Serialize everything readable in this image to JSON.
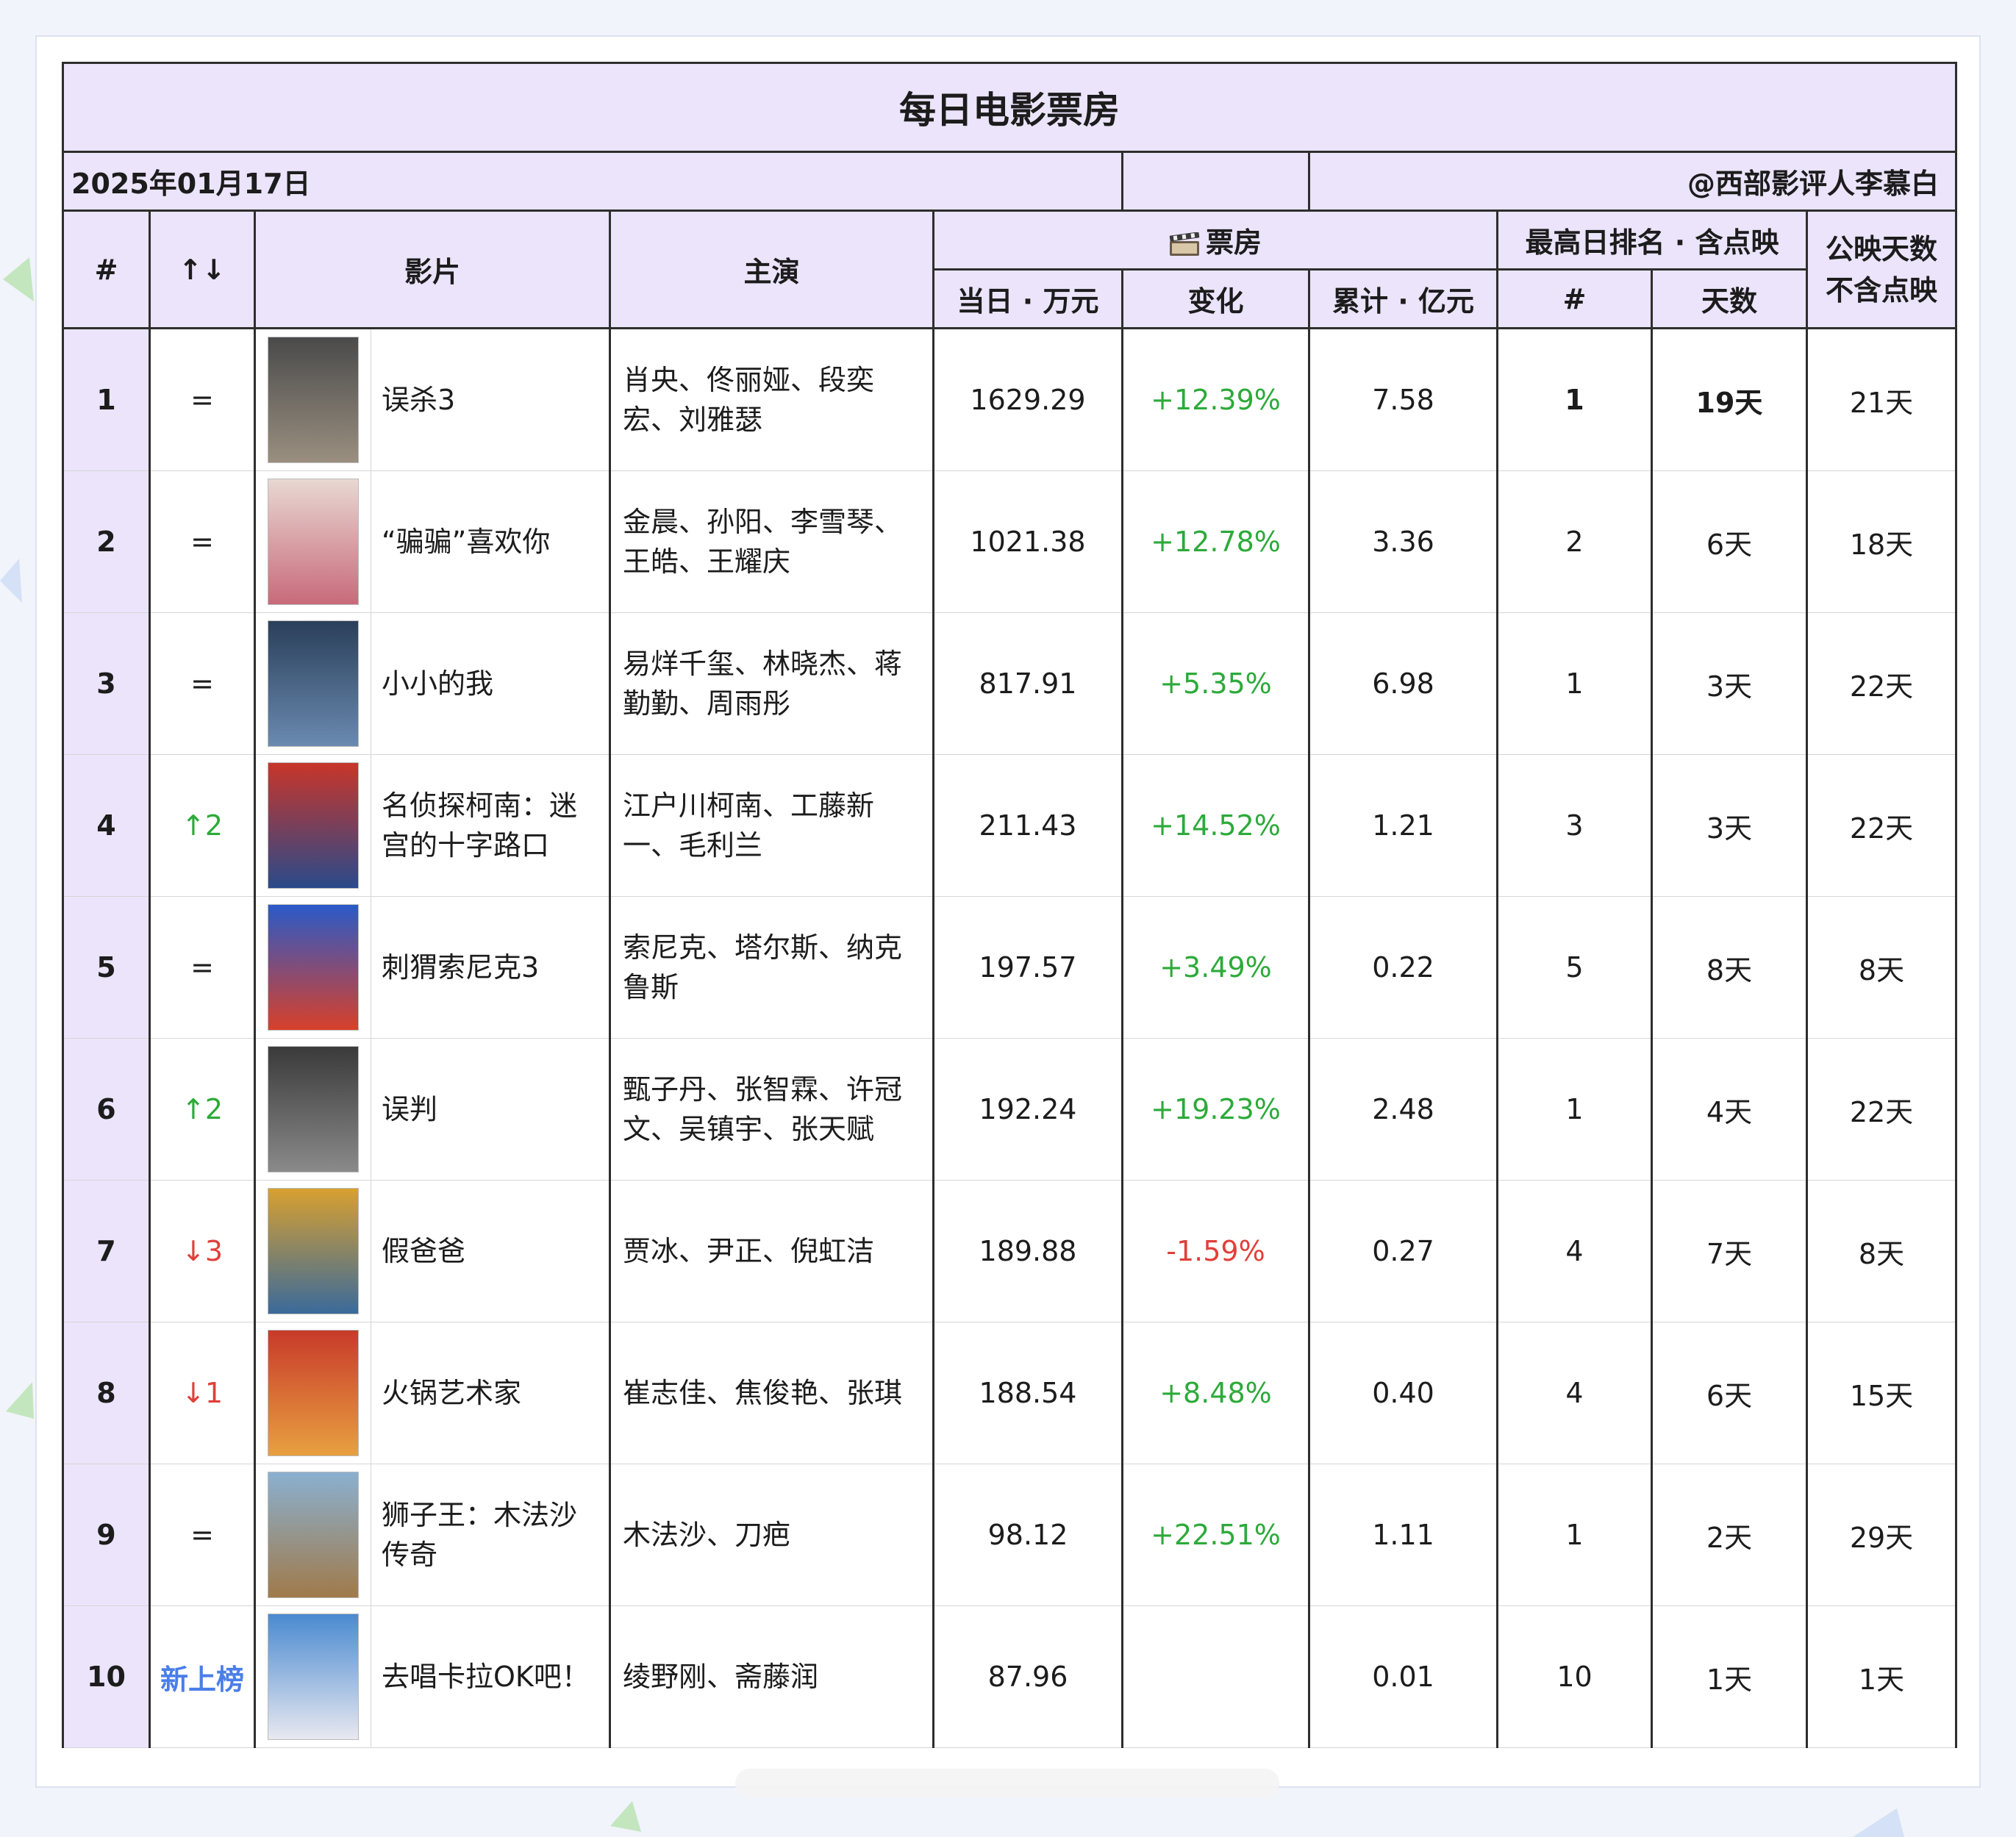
{
  "title": "每日电影票房",
  "date": "2025年01月17日",
  "author": "@西部影评人李慕白",
  "headers": {
    "rank": "#",
    "trend": "↑↓",
    "film": "影片",
    "cast": "主演",
    "box_office_group": "票房",
    "box_office_icon": "film-reel-icon",
    "daily": "当日 · 万元",
    "change": "变化",
    "total": "累计 · 亿元",
    "best_group": "最高日排名 · 含点映",
    "best_rank": "#",
    "best_days": "天数",
    "days_line1": "公映天数",
    "days_line2": "不含点映"
  },
  "colors": {
    "header_bg": "#ebe4fb",
    "up": "#2daa3a",
    "down": "#e0403a",
    "new": "#4a7ee8"
  },
  "rows": [
    {
      "rank": "1",
      "trend": "=",
      "trend_type": "same",
      "film": "误杀3",
      "cast": "肖央、佟丽娅、段奕宏、刘雅瑟",
      "daily": "1629.29",
      "change": "+12.39%",
      "change_type": "pos",
      "total": "7.58",
      "best_rank": "1",
      "best_days": "19天",
      "days": "21天",
      "poster_colors": [
        "#4a4a4a",
        "#9a8f80"
      ]
    },
    {
      "rank": "2",
      "trend": "=",
      "trend_type": "same",
      "film": "“骗骗”喜欢你",
      "cast": "金晨、孙阳、李雪琴、王皓、王耀庆",
      "daily": "1021.38",
      "change": "+12.78%",
      "change_type": "pos",
      "total": "3.36",
      "best_rank": "2",
      "best_days": "6天",
      "days": "18天",
      "poster_colors": [
        "#e8d8d2",
        "#c86a7a"
      ]
    },
    {
      "rank": "3",
      "trend": "=",
      "trend_type": "same",
      "film": "小小的我",
      "cast": "易烊千玺、林晓杰、蒋勤勤、周雨彤",
      "daily": "817.91",
      "change": "+5.35%",
      "change_type": "pos",
      "total": "6.98",
      "best_rank": "1",
      "best_days": "3天",
      "days": "22天",
      "poster_colors": [
        "#2a3f5a",
        "#6a8ab0"
      ]
    },
    {
      "rank": "4",
      "trend": "↑2",
      "trend_type": "up",
      "film": "名侦探柯南：迷宫的十字路口",
      "cast": "江户川柯南、工藤新一、毛利兰",
      "daily": "211.43",
      "change": "+14.52%",
      "change_type": "pos",
      "total": "1.21",
      "best_rank": "3",
      "best_days": "3天",
      "days": "22天",
      "poster_colors": [
        "#c8352a",
        "#2a4a8a"
      ]
    },
    {
      "rank": "5",
      "trend": "=",
      "trend_type": "same",
      "film": "刺猬索尼克3",
      "cast": "索尼克、塔尔斯、纳克鲁斯",
      "daily": "197.57",
      "change": "+3.49%",
      "change_type": "pos",
      "total": "0.22",
      "best_rank": "5",
      "best_days": "8天",
      "days": "8天",
      "poster_colors": [
        "#2a5ac8",
        "#d8402a"
      ]
    },
    {
      "rank": "6",
      "trend": "↑2",
      "trend_type": "up",
      "film": "误判",
      "cast": "甄子丹、张智霖、许冠文、吴镇宇、张天赋",
      "daily": "192.24",
      "change": "+19.23%",
      "change_type": "pos",
      "total": "2.48",
      "best_rank": "1",
      "best_days": "4天",
      "days": "22天",
      "poster_colors": [
        "#3a3a3a",
        "#8a8a8a"
      ]
    },
    {
      "rank": "7",
      "trend": "↓3",
      "trend_type": "down",
      "film": "假爸爸",
      "cast": "贾冰、尹正、倪虹洁",
      "daily": "189.88",
      "change": "-1.59%",
      "change_type": "neg",
      "total": "0.27",
      "best_rank": "4",
      "best_days": "7天",
      "days": "8天",
      "poster_colors": [
        "#d8a030",
        "#3a6a9a"
      ]
    },
    {
      "rank": "8",
      "trend": "↓1",
      "trend_type": "down",
      "film": "火锅艺术家",
      "cast": "崔志佳、焦俊艳、张琪",
      "daily": "188.54",
      "change": "+8.48%",
      "change_type": "pos",
      "total": "0.40",
      "best_rank": "4",
      "best_days": "6天",
      "days": "15天",
      "poster_colors": [
        "#c83a2a",
        "#e8a040"
      ]
    },
    {
      "rank": "9",
      "trend": "=",
      "trend_type": "same",
      "film": "狮子王：木法沙传奇",
      "cast": "木法沙、刀疤",
      "daily": "98.12",
      "change": "+22.51%",
      "change_type": "pos",
      "total": "1.11",
      "best_rank": "1",
      "best_days": "2天",
      "days": "29天",
      "poster_colors": [
        "#8ab0d0",
        "#a07a4a"
      ]
    },
    {
      "rank": "10",
      "trend": "新上榜",
      "trend_type": "new",
      "film": "去唱卡拉OK吧！",
      "cast": "绫野刚、斋藤润",
      "daily": "87.96",
      "change": "",
      "change_type": "none",
      "total": "0.01",
      "best_rank": "10",
      "best_days": "1天",
      "days": "1天",
      "poster_colors": [
        "#4a8ad0",
        "#e8e8f0"
      ]
    }
  ]
}
